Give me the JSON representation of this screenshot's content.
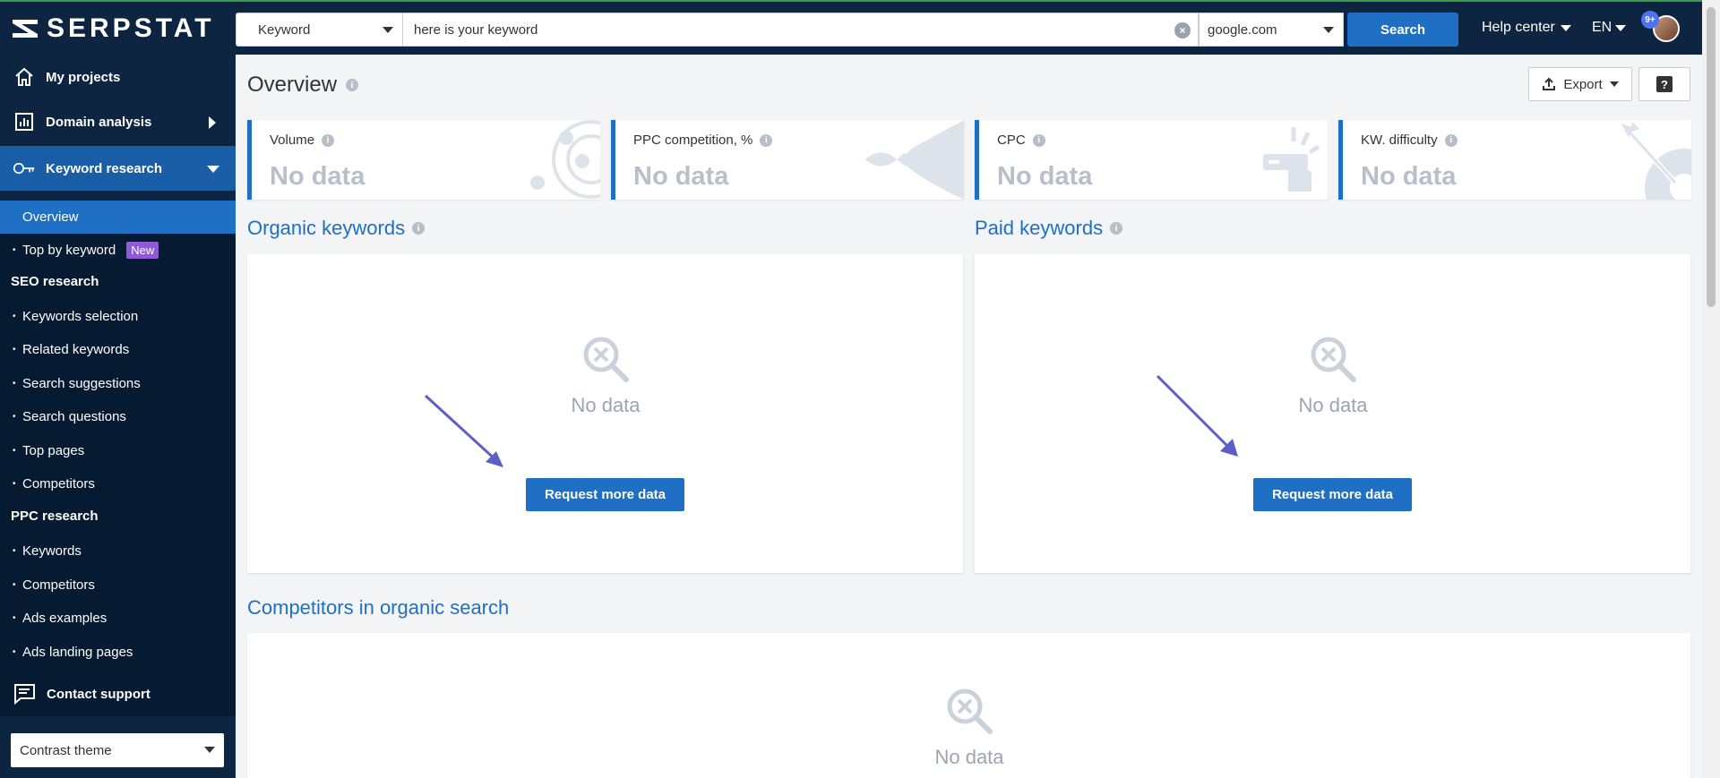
{
  "app": {
    "logo_text": "SERPSTAT"
  },
  "search": {
    "type_value": "Keyword",
    "keyword_value": "here is your keyword",
    "domain_value": "google.com",
    "button_label": "Search"
  },
  "header": {
    "help_center": "Help center",
    "language": "EN",
    "notif_count": "9+"
  },
  "sidebar": {
    "my_projects": "My projects",
    "domain_analysis": "Domain analysis",
    "keyword_research": "Keyword research",
    "overview": "Overview",
    "top_by_keyword": "Top by keyword",
    "new_badge": "New",
    "seo_research": "SEO research",
    "seo_items": [
      "Keywords selection",
      "Related keywords",
      "Search suggestions",
      "Search questions",
      "Top pages",
      "Competitors"
    ],
    "ppc_research": "PPC research",
    "ppc_items": [
      "Keywords",
      "Competitors",
      "Ads examples",
      "Ads landing pages"
    ],
    "contact_support": "Contact support",
    "theme": "Contrast theme"
  },
  "main": {
    "title": "Overview",
    "export_label": "Export",
    "help_label": "?",
    "metrics": [
      {
        "label": "Volume",
        "value": "No data"
      },
      {
        "label": "PPC competition, %",
        "value": "No data"
      },
      {
        "label": "CPC",
        "value": "No data"
      },
      {
        "label": "KW. difficulty",
        "value": "No data"
      }
    ],
    "organic_title": "Organic keywords",
    "paid_title": "Paid keywords",
    "competitors_title": "Competitors in organic search",
    "no_data": "No data",
    "request_label": "Request more data"
  },
  "colors": {
    "accent": "#1f6fc4",
    "sidebar": "#0d2540",
    "badge": "#8e5bd6",
    "annotation": "#5b5fc7"
  }
}
